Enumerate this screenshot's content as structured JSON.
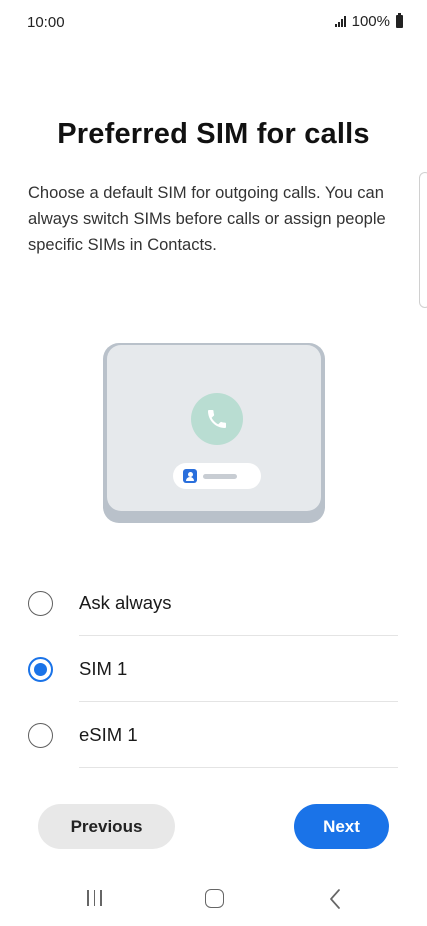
{
  "status_bar": {
    "time": "10:00",
    "battery_text": "100%"
  },
  "page": {
    "title": "Preferred SIM for calls",
    "description": "Choose a default SIM for outgoing calls. You can always switch SIMs before calls or assign people specific SIMs in Contacts."
  },
  "illustration": {
    "icons": [
      "phone-icon",
      "contact-icon"
    ]
  },
  "options": [
    {
      "label": "Ask always",
      "selected": false
    },
    {
      "label": "SIM 1",
      "selected": true
    },
    {
      "label": "eSIM 1",
      "selected": false
    }
  ],
  "buttons": {
    "previous_label": "Previous",
    "next_label": "Next"
  },
  "colors": {
    "accent": "#1a73e8",
    "call_circle": "#b9ddd2",
    "device": "#e6e9ec"
  },
  "nav_bar": {
    "icons": [
      "recents-icon",
      "home-icon",
      "back-icon"
    ]
  }
}
